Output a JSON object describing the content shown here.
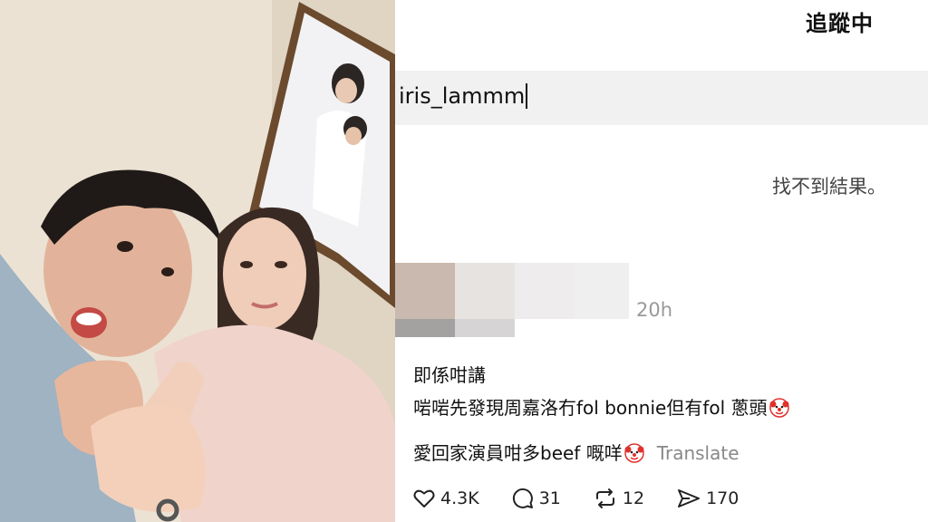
{
  "header": {
    "title": "追蹤中"
  },
  "search": {
    "query": "iris_lammm"
  },
  "results": {
    "empty_message": "找不到結果。"
  },
  "post": {
    "timestamp": "20h",
    "line1": "即係咁講",
    "line2": "啱啱先發現周嘉洛冇fol bonnie但有fol 蔥頭",
    "line3": "愛回家演員咁多beef 嘅咩",
    "translate_label": "Translate",
    "likes": "4.3K",
    "comments": "31",
    "reposts": "12",
    "shares": "170",
    "emoji_icon": "clown-face-icon"
  },
  "colors": {
    "search_bg": "#f1f1f2",
    "muted_text": "#888888",
    "clown_red": "#e0312c"
  }
}
